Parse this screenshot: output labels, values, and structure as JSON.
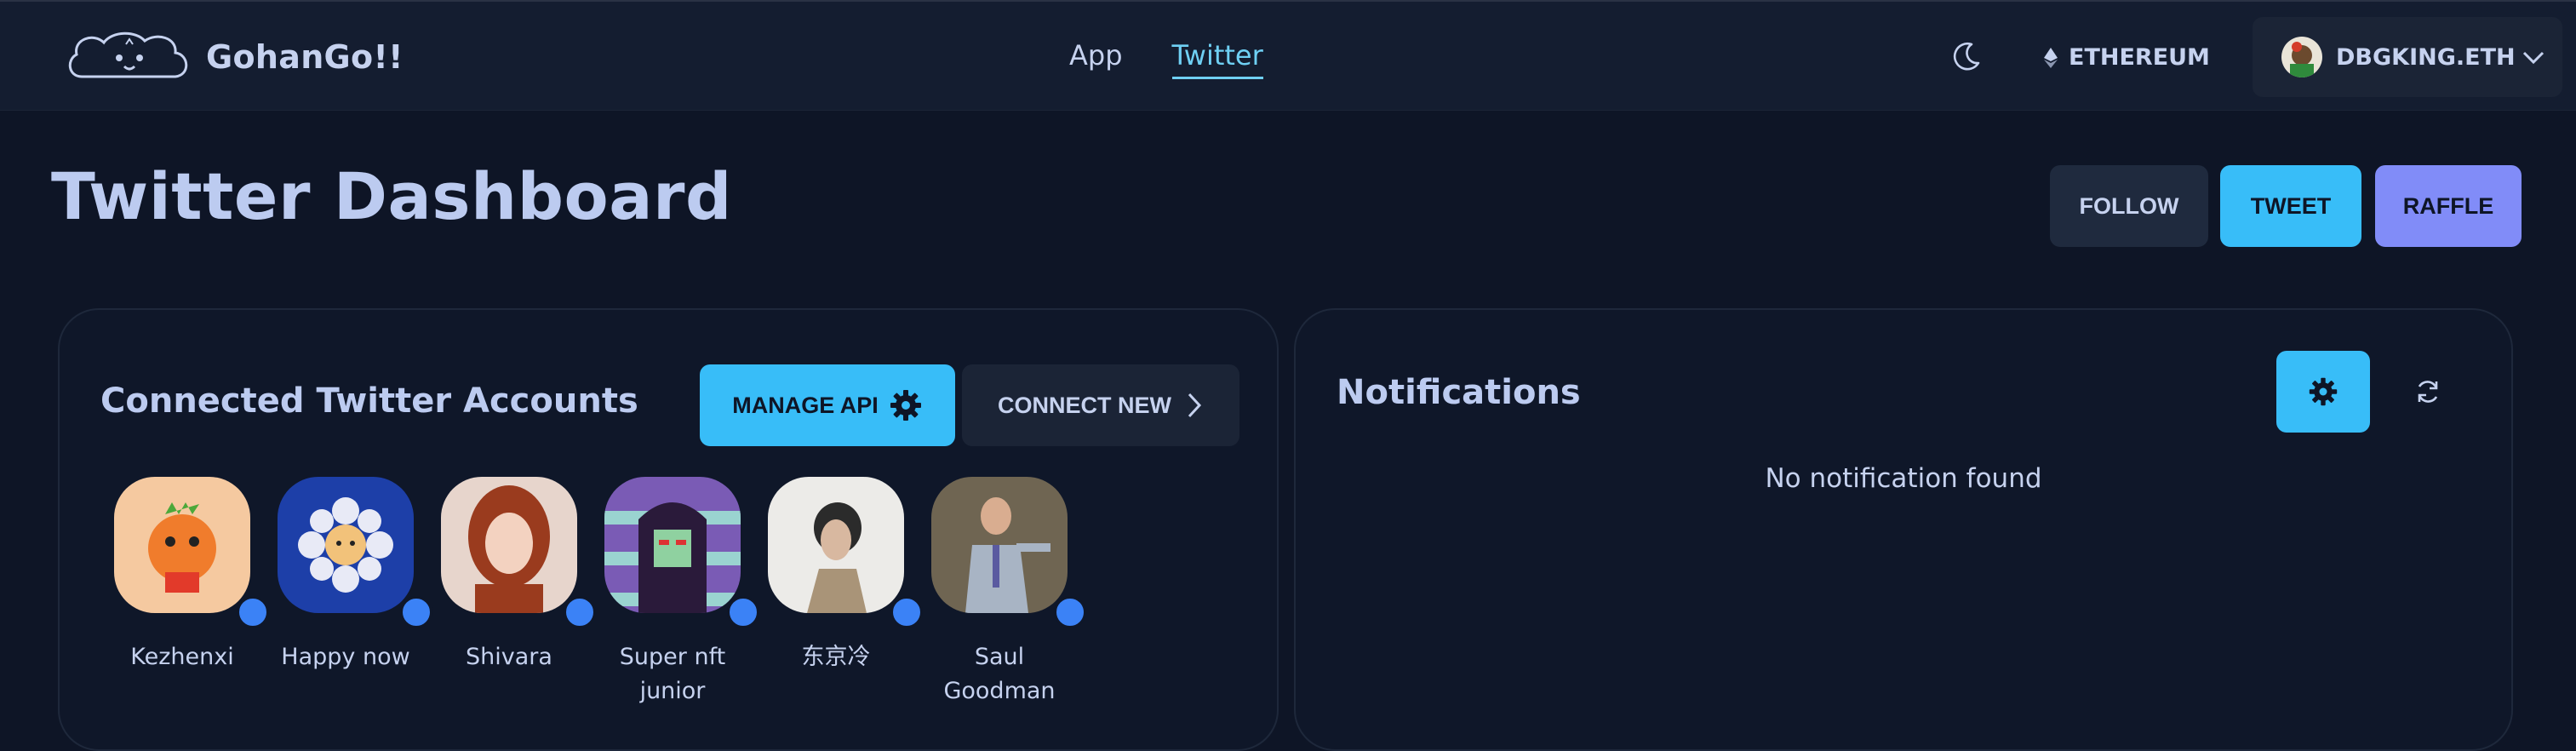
{
  "header": {
    "brand": "GohanGo!!",
    "nav": [
      "App",
      "Twitter"
    ],
    "network": "ETHEREUM",
    "account": "DBGKING.ETH"
  },
  "page": {
    "title": "Twitter Dashboard",
    "actions": {
      "follow": "FOLLOW",
      "tweet": "TWEET",
      "raffle": "RAFFLE"
    }
  },
  "accounts_panel": {
    "title": "Connected Twitter Accounts",
    "manage_label": "MANAGE API",
    "connect_label": "CONNECT NEW",
    "accounts": [
      {
        "name": "Kezhenxi"
      },
      {
        "name": "Happy now"
      },
      {
        "name": "Shivara"
      },
      {
        "name": "Super nft junior"
      },
      {
        "name": "东京冷"
      },
      {
        "name": "Saul Goodman"
      }
    ]
  },
  "notifications_panel": {
    "title": "Notifications",
    "empty_text": "No notification found"
  },
  "colors": {
    "accent_blue": "#38bdf8",
    "accent_violet": "#818cf8",
    "status_dot": "#3b82f6",
    "background": "#0e1526"
  }
}
